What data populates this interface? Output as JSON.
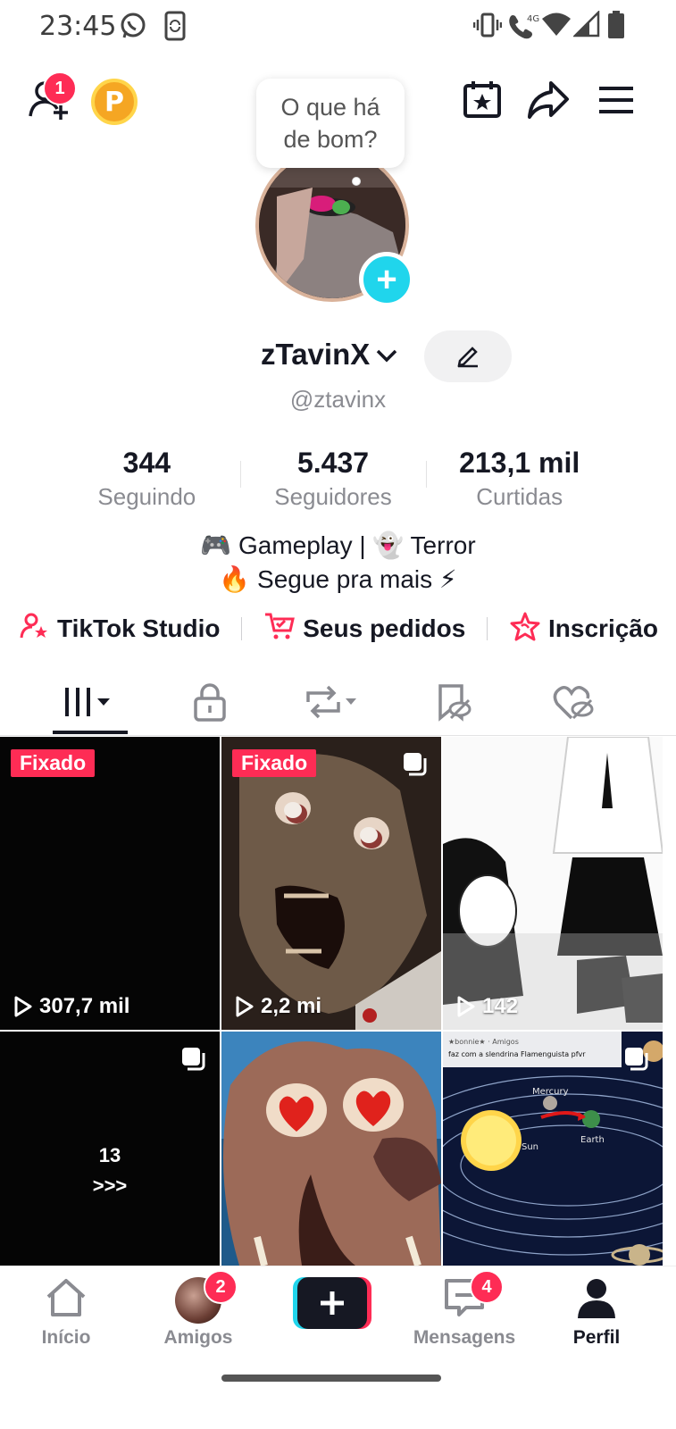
{
  "status_bar": {
    "time": "23:45",
    "network": "4G"
  },
  "header": {
    "add_friend_badge": "1",
    "coin_letter": "P",
    "bubble_text": "O que há de bom?"
  },
  "profile": {
    "username": "zTavinX",
    "handle": "@ztavinx",
    "stats": [
      {
        "value": "344",
        "label": "Seguindo"
      },
      {
        "value": "5.437",
        "label": "Seguidores"
      },
      {
        "value": "213,1 mil",
        "label": "Curtidas"
      }
    ],
    "bio_line_1": "🎮 Gameplay | 👻 Terror",
    "bio_line_2": "🔥 Segue pra mais ⚡",
    "links": [
      {
        "label": "TikTok Studio",
        "icon": "person-star-icon"
      },
      {
        "label": "Seus pedidos",
        "icon": "cart-icon"
      },
      {
        "label": "Inscrição",
        "icon": "star-heart-icon"
      }
    ]
  },
  "tabs": [
    "videos",
    "private",
    "reposts",
    "favorites",
    "liked"
  ],
  "videos": [
    {
      "pinned_label": "Fixado",
      "views": "307,7 mil",
      "multi": false
    },
    {
      "pinned_label": "Fixado",
      "views": "2,2 mi",
      "multi": true
    },
    {
      "pinned_label": "",
      "views": "142",
      "multi": true
    },
    {
      "overlay_line_1": "13",
      "overlay_line_2": ">>>",
      "multi": true
    },
    {
      "multi": false
    },
    {
      "thumb_text": "★bonnie★ · Amigos",
      "thumb_text_2": "faz com a slendrina Flamenguista pfvr",
      "planet_1": "Mercury",
      "planet_2": "Earth",
      "planet_3": "Sun",
      "multi": true
    }
  ],
  "bottom_nav": {
    "home": "Início",
    "friends": "Amigos",
    "friends_badge": "2",
    "messages": "Mensagens",
    "messages_badge": "4",
    "profile": "Perfil"
  },
  "colors": {
    "accent": "#fe2c55",
    "cyan": "#20d5ec",
    "text": "#161823",
    "muted": "#8a8b91"
  }
}
